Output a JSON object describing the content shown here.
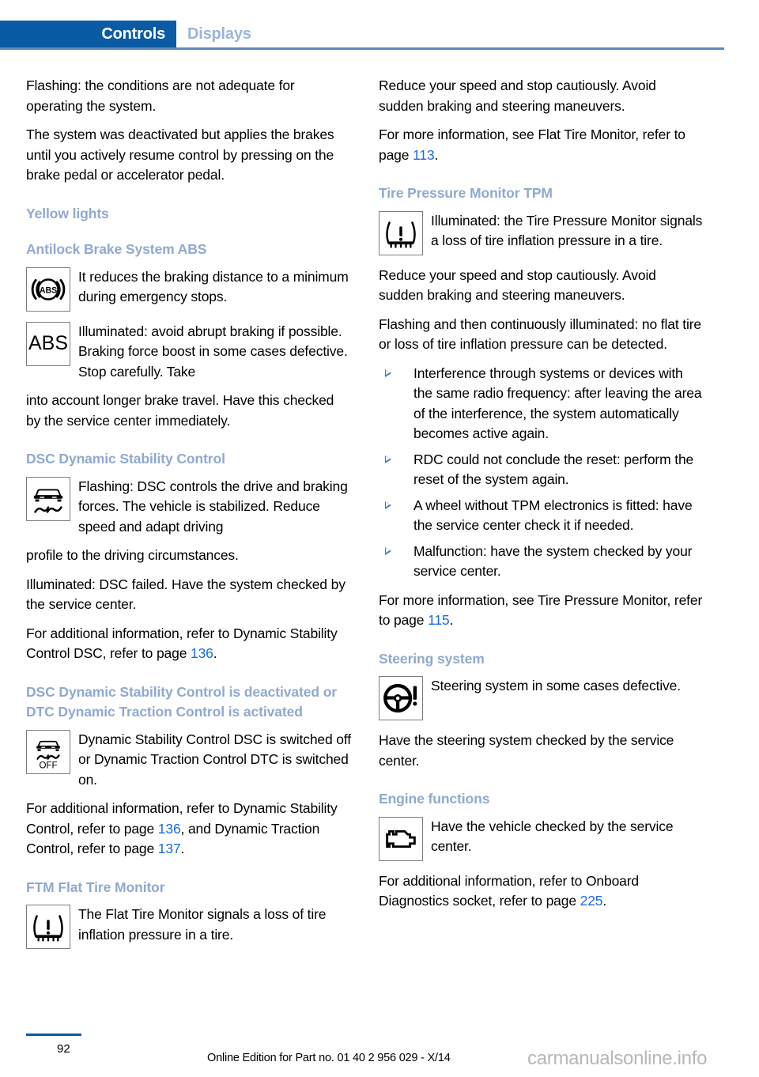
{
  "header": {
    "tab_active": "Controls",
    "tab_inactive": "Displays",
    "accent_blue": "#0a5ba3",
    "inactive_blue": "#9bb4da"
  },
  "colors": {
    "heading_blue": "#8fa9d0",
    "link_blue": "#1a6bdb",
    "bullet_blue": "#3f7fd4"
  },
  "left_column": {
    "para_flashing": "Flashing: the conditions are not adequate for operating the system.",
    "para_deactivated": "The system was deactivated but applies the brakes until you actively resume control by pressing on the brake pedal or accelerator pedal.",
    "heading_yellow_lights": "Yellow lights",
    "heading_abs": "Antilock Brake System ABS",
    "abs_icon_1_name": "abs-ring-icon",
    "abs_text_1": "It reduces the braking distance to a minimum during emergency stops.",
    "abs_icon_2_name": "abs-text-icon",
    "abs_icon_2_label": "ABS",
    "abs_text_2": "Illuminated: avoid abrupt braking if pos­sible. Braking force boost in some cases defective. Stop carefully. Take",
    "abs_text_2_cont": "into account longer brake travel. Have this checked by the service center immediately.",
    "heading_dsc": "DSC Dynamic Stability Control",
    "dsc_icon_name": "dsc-car-skid-icon",
    "dsc_text_1": "Flashing: DSC controls the drive and braking forces. The vehicle is stabi­lized. Reduce speed and adapt driving",
    "dsc_text_1_cont": "profile to the driving circumstances.",
    "dsc_text_2": "Illuminated: DSC failed. Have the system checked by the service center.",
    "dsc_text_3_a": "For additional information, refer to Dynamic Stability Control DSC, refer to page ",
    "dsc_text_3_ref": "136",
    "dsc_text_3_b": ".",
    "heading_dsc_off": "DSC Dynamic Stability Control is deactivated or DTC Dynamic Traction Control is activated",
    "dsc_off_icon_name": "dsc-off-icon",
    "dsc_off_icon_label": "OFF",
    "dsc_off_text": "Dynamic Stability Control DSC is switched off or Dynamic Traction Con­trol DTC is switched on.",
    "dsc_off_more_a": "For additional information, refer to Dynamic Stability Control, refer to page ",
    "dsc_off_more_ref1": "136",
    "dsc_off_more_b": ", and Dy­namic Traction Control, refer to page ",
    "dsc_off_more_ref2": "137",
    "dsc_off_more_c": ".",
    "heading_ftm": "FTM Flat Tire Monitor",
    "ftm_icon_name": "tire-pressure-warning-icon",
    "ftm_text": "The Flat Tire Monitor signals a loss of tire inflation pressure in a tire."
  },
  "right_column": {
    "para_reduce_speed": "Reduce your speed and stop cautiously. Avoid sudden braking and steering maneuvers.",
    "para_more_info_a": "For more information, see Flat Tire Monitor, re­fer to page ",
    "para_more_info_ref": "113",
    "para_more_info_b": ".",
    "heading_tpm": "Tire Pressure Monitor TPM",
    "tpm_icon_name": "tire-pressure-warning-icon",
    "tpm_text": "Illuminated: the Tire Pressure Monitor signals a loss of tire inflation pressure in a tire.",
    "tpm_reduce_speed": "Reduce your speed and stop cautiously. Avoid sudden braking and steering maneuvers.",
    "tpm_flashing": "Flashing and then continuously illuminated: no flat tire or loss of tire inflation pressure can be detected.",
    "bullets": [
      "Interference through systems or devices with the same radio frequency: after leav­ing the area of the interference, the system automatically becomes active again.",
      "RDC could not conclude the reset: perform the reset of the system again.",
      "A wheel without TPM electronics is fitted: have the service center check it if needed.",
      "Malfunction: have the system checked by your service center."
    ],
    "tpm_more_a": "For more information, see Tire Pressure Moni­tor, refer to page ",
    "tpm_more_ref": "115",
    "tpm_more_b": ".",
    "heading_steering": "Steering system",
    "steering_icon_name": "steering-wheel-warning-icon",
    "steering_text_1": "Steering system in some cases defec­tive.",
    "steering_text_2": "Have the steering system checked by the service center.",
    "heading_engine": "Engine functions",
    "engine_icon_name": "check-engine-icon",
    "engine_text_1": "Have the vehicle checked by the serv­ice center.",
    "engine_text_2_a": "For additional information, refer to On­board Diagnostics socket, refer to page ",
    "engine_text_2_ref": "225",
    "engine_text_2_b": "."
  },
  "footer": {
    "page_number": "92",
    "edition_note": "Online Edition for Part no. 01 40 2 956 029 - X/14",
    "watermark": "carmanualsonline.info"
  }
}
